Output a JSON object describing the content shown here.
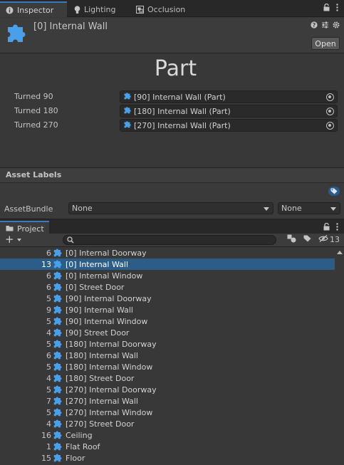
{
  "tabs": {
    "inspector": "Inspector",
    "lighting": "Lighting",
    "occlusion": "Occlusion"
  },
  "inspector": {
    "object_title": "[0] Internal Wall",
    "open_label": "Open",
    "part_heading": "Part",
    "fields": [
      {
        "label": "Turned 90",
        "value": "[90] Internal Wall (Part)"
      },
      {
        "label": "Turned 180",
        "value": "[180] Internal Wall (Part)"
      },
      {
        "label": "Turned 270",
        "value": "[270] Internal Wall (Part)"
      }
    ]
  },
  "asset_labels": {
    "header": "Asset Labels",
    "assetbundle_label": "AssetBundle",
    "bundle_value": "None",
    "variant_value": "None"
  },
  "project": {
    "tab_label": "Project",
    "search_placeholder": "",
    "hidden_count": "13",
    "items": [
      {
        "count": "6",
        "name": "[0] Internal Doorway"
      },
      {
        "count": "13",
        "name": "[0] Internal Wall",
        "selected": true
      },
      {
        "count": "6",
        "name": "[0] Internal Window"
      },
      {
        "count": "6",
        "name": "[0] Street Door"
      },
      {
        "count": "5",
        "name": "[90] Internal Doorway"
      },
      {
        "count": "9",
        "name": "[90] Internal Wall"
      },
      {
        "count": "5",
        "name": "[90] Internal Window"
      },
      {
        "count": "4",
        "name": "[90] Street Door"
      },
      {
        "count": "5",
        "name": "[180] Internal Doorway"
      },
      {
        "count": "6",
        "name": "[180] Internal Wall"
      },
      {
        "count": "5",
        "name": "[180] Internal Window"
      },
      {
        "count": "4",
        "name": "[180] Street Door"
      },
      {
        "count": "5",
        "name": "[270] Internal Doorway"
      },
      {
        "count": "7",
        "name": "[270] Internal Wall"
      },
      {
        "count": "5",
        "name": "[270] Internal Window"
      },
      {
        "count": "4",
        "name": "[270] Street Door"
      },
      {
        "count": "16",
        "name": "Ceiling"
      },
      {
        "count": "1",
        "name": "Flat Roof"
      },
      {
        "count": "15",
        "name": "Floor"
      }
    ]
  },
  "colors": {
    "accent": "#3a79bb",
    "selection": "#2c5d87",
    "puzzle_icon": "#4a9fe8"
  }
}
